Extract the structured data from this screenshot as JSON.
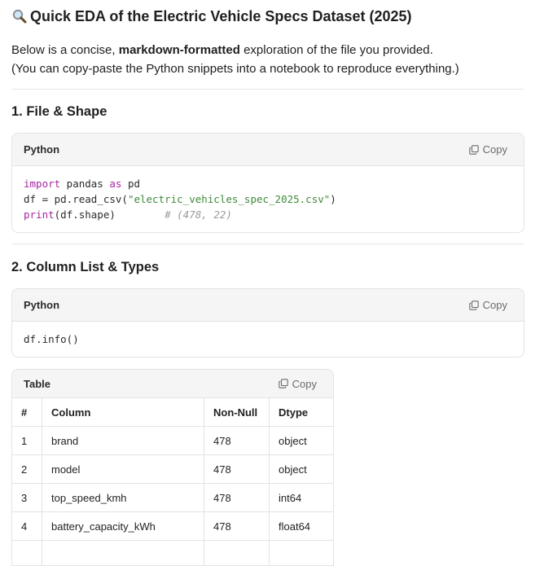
{
  "title": {
    "icon": "magnifier-icon",
    "text": "Quick EDA of the Electric Vehicle Specs Dataset (2025)"
  },
  "intro": {
    "line1_prefix": "Below is a concise, ",
    "line1_bold": "markdown-formatted",
    "line1_suffix": " exploration of the file you provided.",
    "line2": "(You can copy-paste the Python snippets into a notebook to reproduce everything.)"
  },
  "sections": [
    {
      "heading": "1. File & Shape",
      "code": {
        "language": "Python",
        "copy_label": "Copy",
        "lines": [
          [
            {
              "t": "kw",
              "v": "import"
            },
            {
              "t": "txt",
              "v": " pandas "
            },
            {
              "t": "kw",
              "v": "as"
            },
            {
              "t": "txt",
              "v": " pd"
            }
          ],
          [
            {
              "t": "txt",
              "v": "df = pd.read_csv("
            },
            {
              "t": "str",
              "v": "\"electric_vehicles_spec_2025.csv\""
            },
            {
              "t": "txt",
              "v": ")"
            }
          ],
          [
            {
              "t": "kw",
              "v": "print"
            },
            {
              "t": "txt",
              "v": "(df.shape)        "
            },
            {
              "t": "cmt",
              "v": "# (478, 22)"
            }
          ]
        ]
      }
    },
    {
      "heading": "2. Column List & Types",
      "code": {
        "language": "Python",
        "copy_label": "Copy",
        "lines": [
          [
            {
              "t": "txt",
              "v": "df.info()"
            }
          ]
        ]
      }
    }
  ],
  "table": {
    "label": "Table",
    "copy_label": "Copy",
    "headers": [
      "#",
      "Column",
      "Non-Null",
      "Dtype"
    ],
    "rows": [
      [
        "1",
        "brand",
        "478",
        "object"
      ],
      [
        "2",
        "model",
        "478",
        "object"
      ],
      [
        "3",
        "top_speed_kmh",
        "478",
        "int64"
      ],
      [
        "4",
        "battery_capacity_kWh",
        "478",
        "float64"
      ],
      [
        "",
        "",
        "",
        ""
      ]
    ]
  }
}
